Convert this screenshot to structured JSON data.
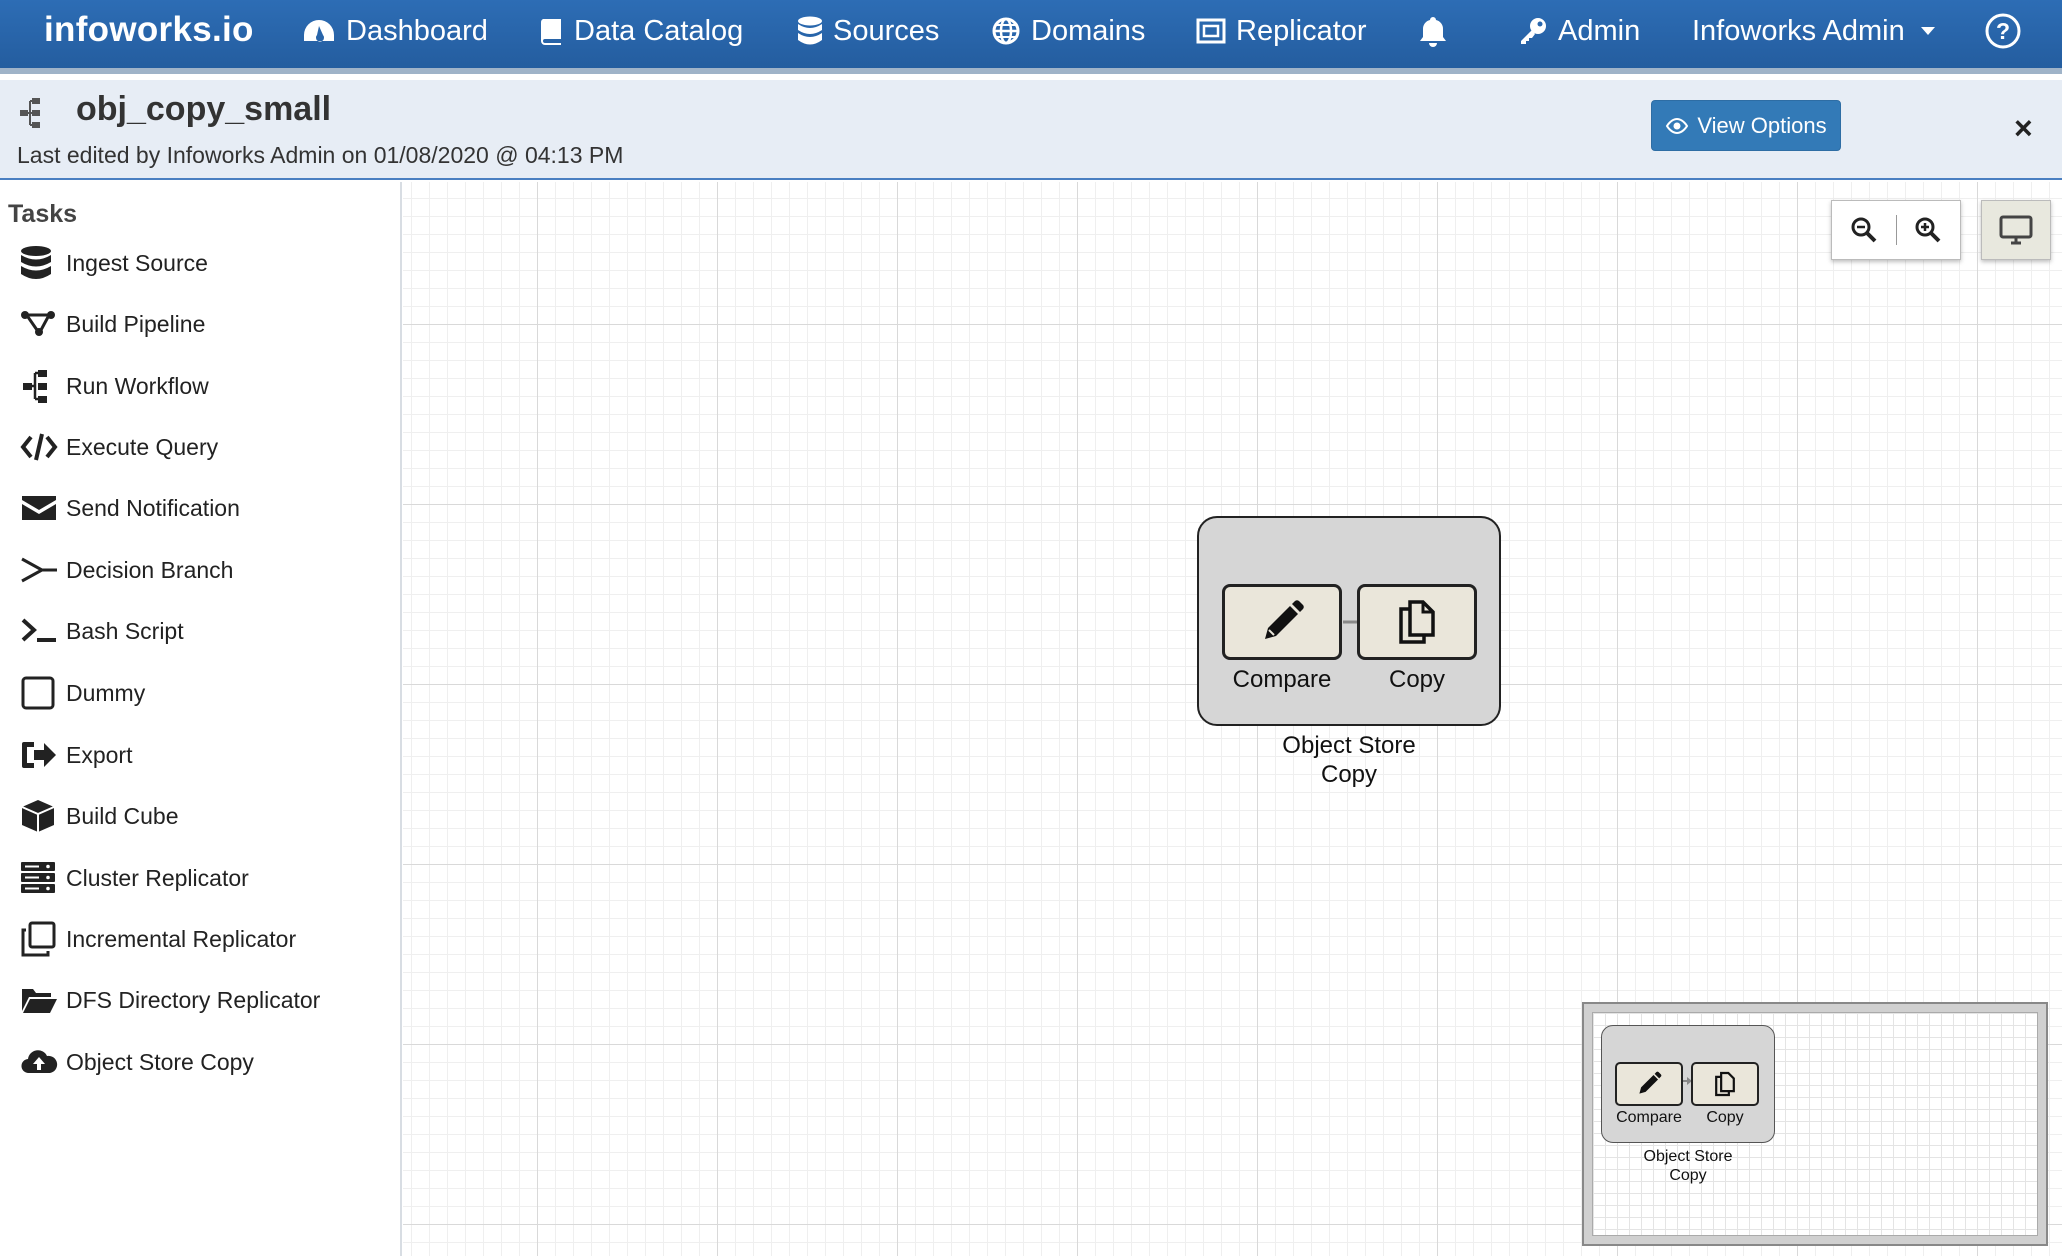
{
  "nav": {
    "brand": "infoworks.io",
    "items": [
      {
        "label": "Dashboard",
        "icon": "dashboard-icon"
      },
      {
        "label": "Data Catalog",
        "icon": "book-icon"
      },
      {
        "label": "Sources",
        "icon": "database-icon"
      },
      {
        "label": "Domains",
        "icon": "globe-icon"
      },
      {
        "label": "Replicator",
        "icon": "replicator-icon"
      },
      {
        "label": "Admin",
        "icon": "key-icon"
      }
    ],
    "user": "Infoworks Admin",
    "bell_icon": "bell-icon",
    "help_icon": "help-icon"
  },
  "header": {
    "title": "obj_copy_small",
    "subtitle": "Last edited by Infoworks Admin on 01/08/2020 @ 04:13 PM",
    "view_options": "View Options",
    "close": "×"
  },
  "sidebar": {
    "title": "Tasks",
    "items": [
      {
        "label": "Ingest Source",
        "icon": "database-icon"
      },
      {
        "label": "Build Pipeline",
        "icon": "pipeline-icon"
      },
      {
        "label": "Run Workflow",
        "icon": "workflow-icon"
      },
      {
        "label": "Execute Query",
        "icon": "code-icon"
      },
      {
        "label": "Send Notification",
        "icon": "envelope-icon"
      },
      {
        "label": "Decision Branch",
        "icon": "branch-icon"
      },
      {
        "label": "Bash Script",
        "icon": "terminal-icon"
      },
      {
        "label": "Dummy",
        "icon": "square-icon"
      },
      {
        "label": "Export",
        "icon": "export-icon"
      },
      {
        "label": "Build Cube",
        "icon": "cube-icon"
      },
      {
        "label": "Cluster Replicator",
        "icon": "server-icon"
      },
      {
        "label": "Incremental Replicator",
        "icon": "clone-icon"
      },
      {
        "label": "DFS Directory Replicator",
        "icon": "folder-open-icon"
      },
      {
        "label": "Object Store Copy",
        "icon": "cloud-upload-icon"
      }
    ]
  },
  "canvas": {
    "group_label_line1": "Object Store",
    "group_label_line2": "Copy",
    "nodes": [
      {
        "label": "Compare",
        "icon": "pencil-icon"
      },
      {
        "label": "Copy",
        "icon": "copy-icon"
      }
    ]
  },
  "minimap": {
    "group_label_line1": "Object Store",
    "group_label_line2": "Copy",
    "nodes": [
      {
        "label": "Compare"
      },
      {
        "label": "Copy"
      }
    ]
  },
  "colors": {
    "navbar": "#2a67ad",
    "primary_button": "#337ab7",
    "header_bg": "#e7edf5",
    "node_fill": "#eae6da",
    "group_fill": "#d6d6d6"
  }
}
